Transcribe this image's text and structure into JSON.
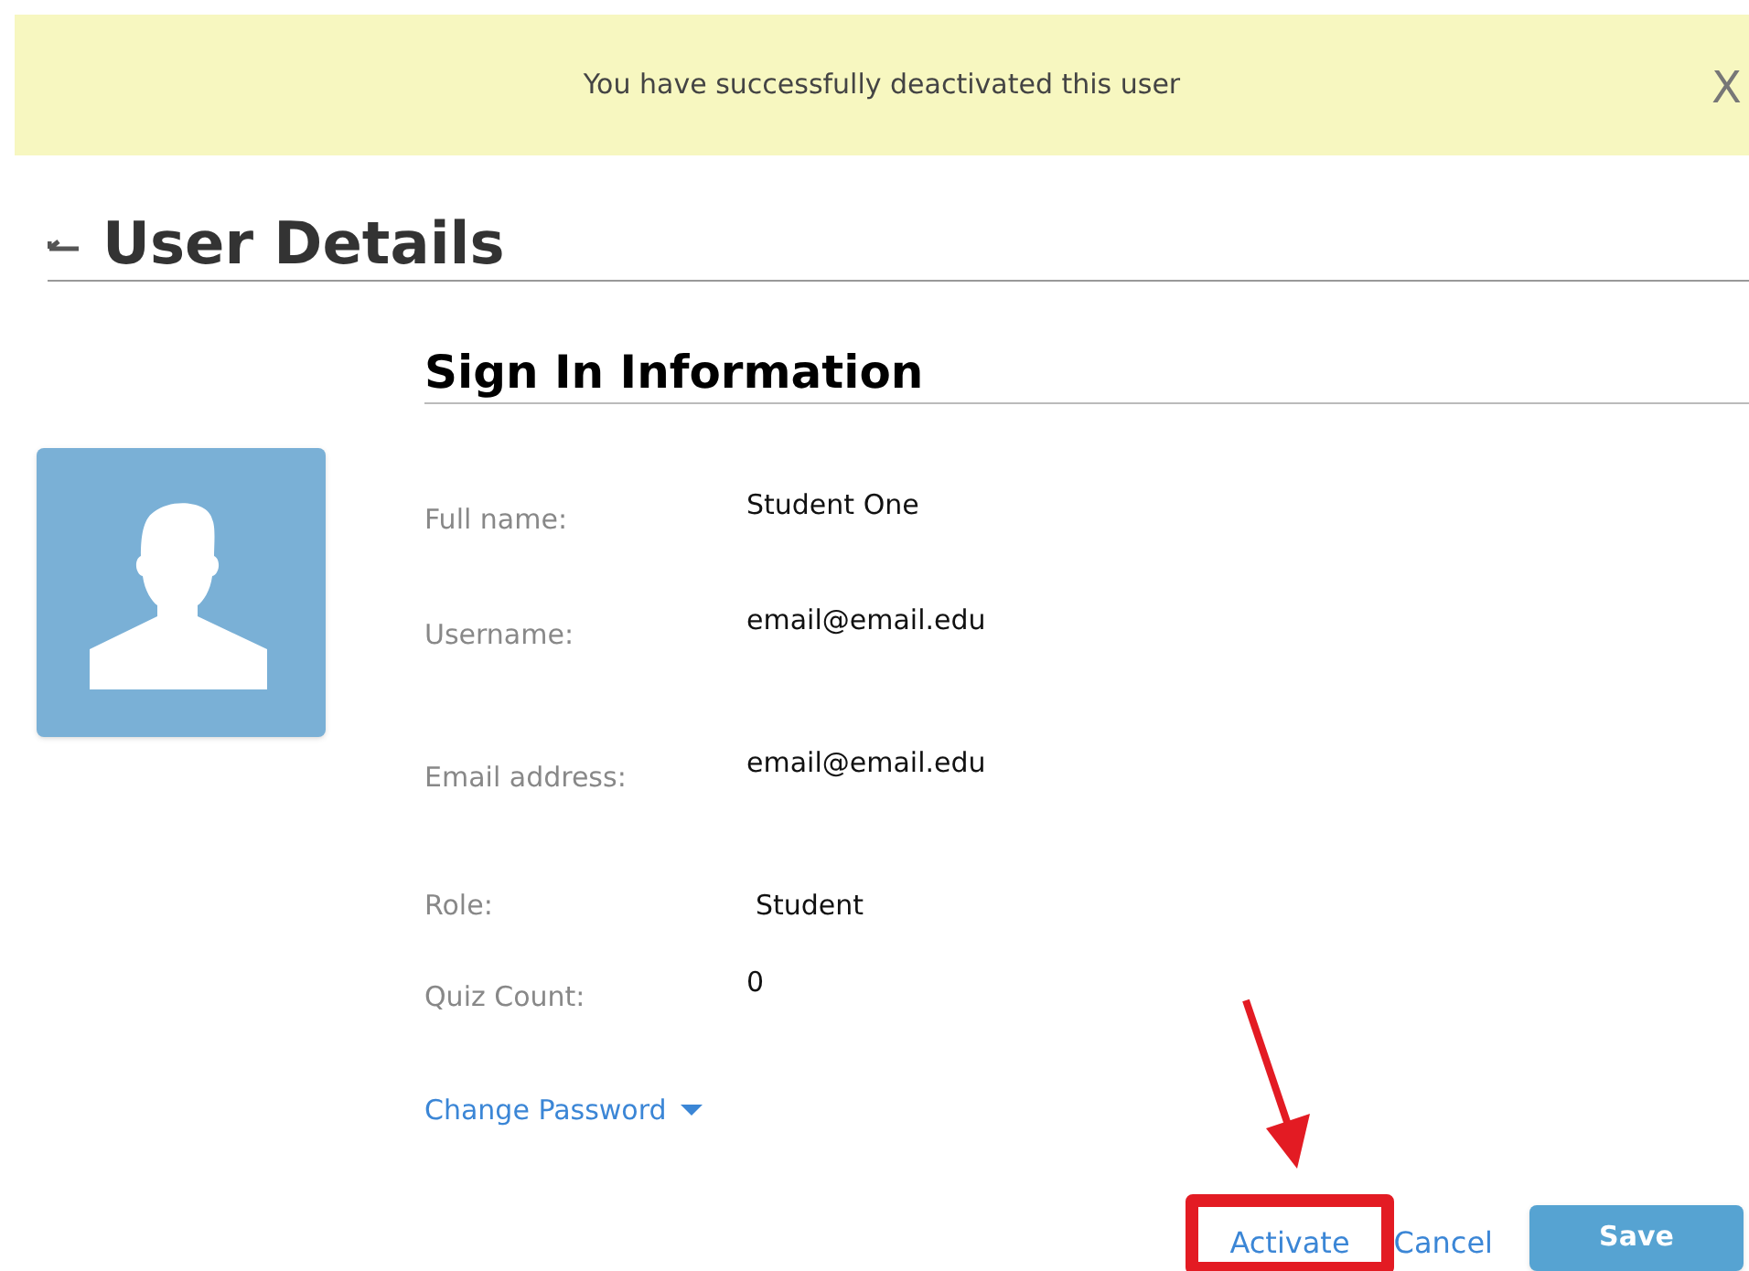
{
  "banner": {
    "message": "You have successfully deactivated this user",
    "close": "X"
  },
  "page_title": "User Details",
  "section_title": "Sign In Information",
  "fields": [
    {
      "label": "Full name:",
      "value": "Student One"
    },
    {
      "label": "Username:",
      "value": "email@email.edu"
    },
    {
      "label": "Email address:",
      "value": "email@email.edu"
    },
    {
      "label": "Role:",
      "value": "Student"
    },
    {
      "label": "Quiz Count:",
      "value": "0"
    }
  ],
  "change_password": {
    "label": "Change Password",
    "expanded": false
  },
  "actions": [
    {
      "kind": "link",
      "label": "Activate",
      "highlighted": true
    },
    {
      "kind": "link",
      "label": "Cancel",
      "highlighted": false
    },
    {
      "kind": "primary",
      "label": "Save",
      "highlighted": false
    }
  ]
}
